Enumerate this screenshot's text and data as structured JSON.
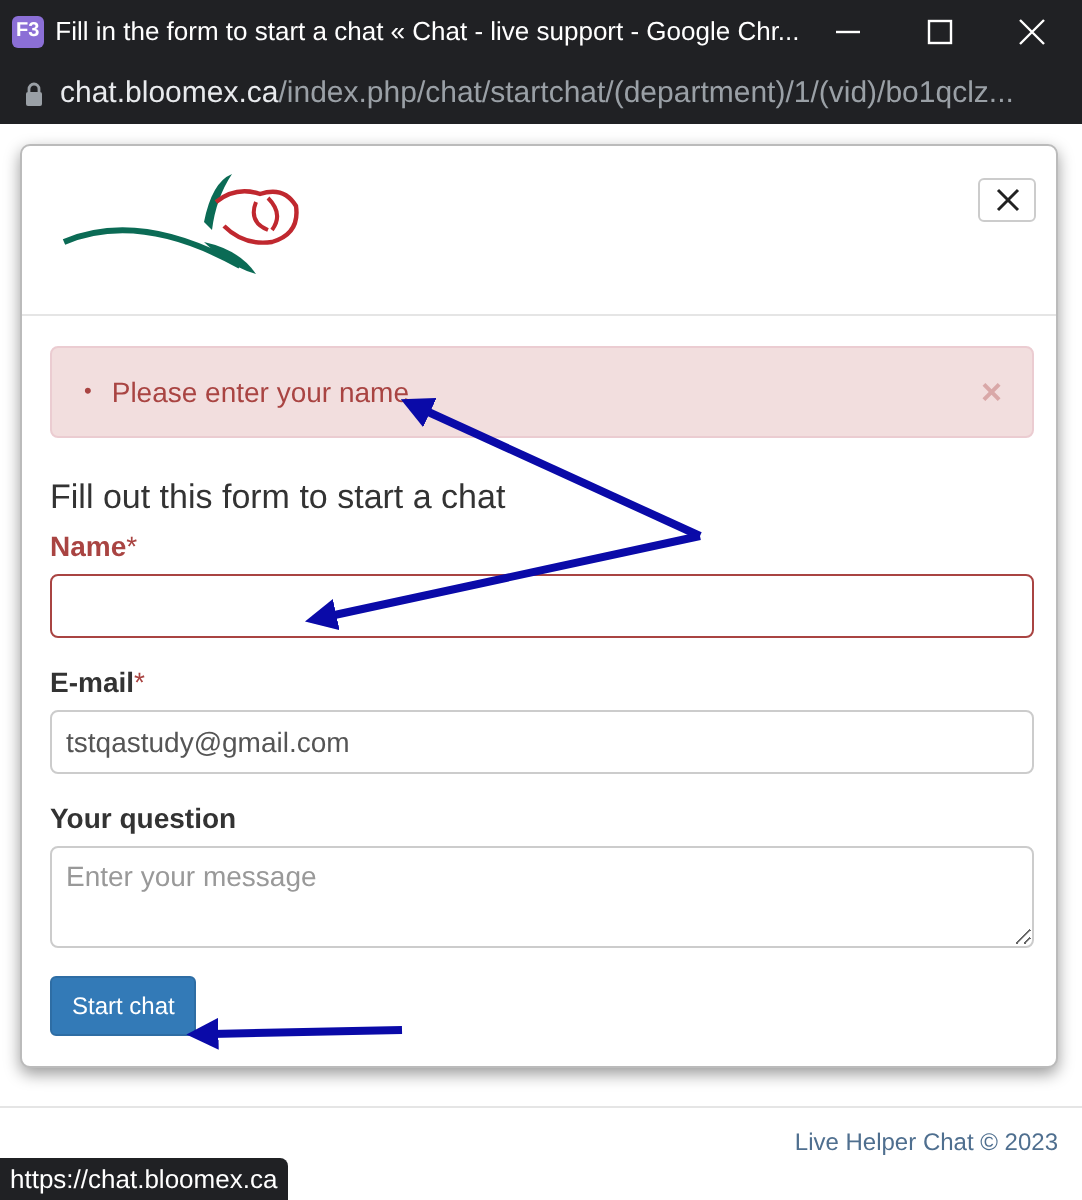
{
  "window": {
    "title": "Fill in the form to start a chat « Chat - live support - Google Chr...",
    "app_icon": "F3"
  },
  "address_bar": {
    "host": "chat.bloomex.ca",
    "path": "/index.php/chat/startchat/(department)/1/(vid)/bo1qclz..."
  },
  "alert": {
    "bullet": "•",
    "messages": [
      "Please enter your name"
    ],
    "close": "×"
  },
  "form": {
    "heading": "Fill out this form to start a chat",
    "fields": [
      {
        "kind": "input",
        "label": "Name",
        "required_mark": "*",
        "invalid": true
      },
      {
        "kind": "input",
        "label": "E-mail",
        "required_mark": "*",
        "invalid": false,
        "value": "tstqastudy@gmail.com"
      },
      {
        "kind": "textarea",
        "label": "Your question",
        "invalid": false,
        "placeholder": "Enter your message"
      }
    ],
    "submit": "Start chat"
  },
  "footer": {
    "text": "Live Helper Chat © 2023"
  },
  "status_tooltip": "https://chat.bloomex.ca"
}
